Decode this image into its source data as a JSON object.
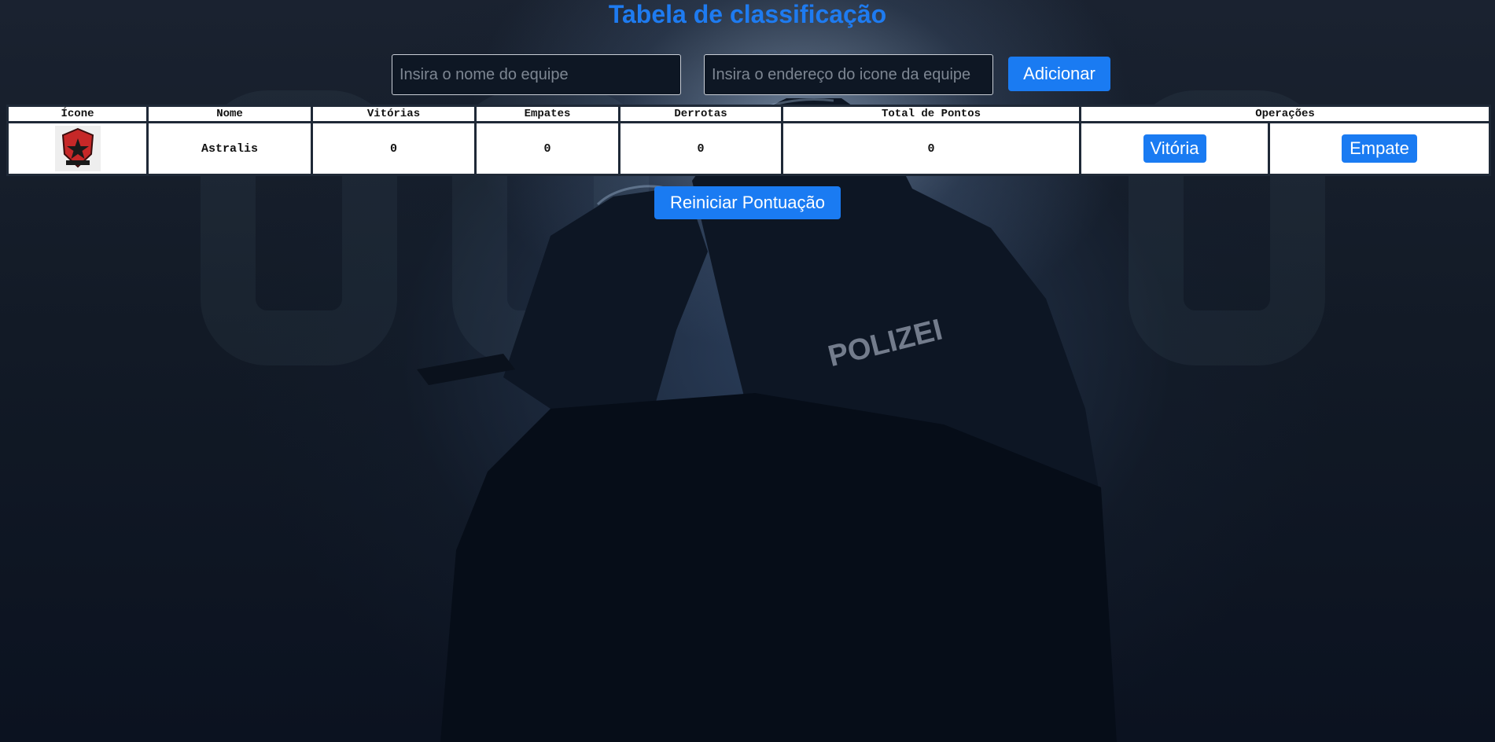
{
  "page": {
    "title": "Tabela de classificação"
  },
  "form": {
    "team_name_placeholder": "Insira o nome do equipe",
    "team_icon_placeholder": "Insira o endereço do icone da equipe",
    "add_label": "Adicionar"
  },
  "table": {
    "headers": {
      "icon": "Ícone",
      "name": "Nome",
      "wins": "Vitórias",
      "draws": "Empates",
      "losses": "Derrotas",
      "points": "Total de Pontos",
      "operations": "Operações"
    },
    "rows": [
      {
        "icon": "team-logo-icon",
        "name": "Astralis",
        "wins": "0",
        "draws": "0",
        "losses": "0",
        "points": "0",
        "win_label": "Vitória",
        "draw_label": "Empate"
      }
    ]
  },
  "reset_label": "Reiniciar Pontuação",
  "background": {
    "emblem_text": "POLIZEI"
  },
  "colors": {
    "accent": "#1a7bf2",
    "title": "#1e7bf0",
    "background": "#121a26",
    "table_border": "#1f2937"
  }
}
